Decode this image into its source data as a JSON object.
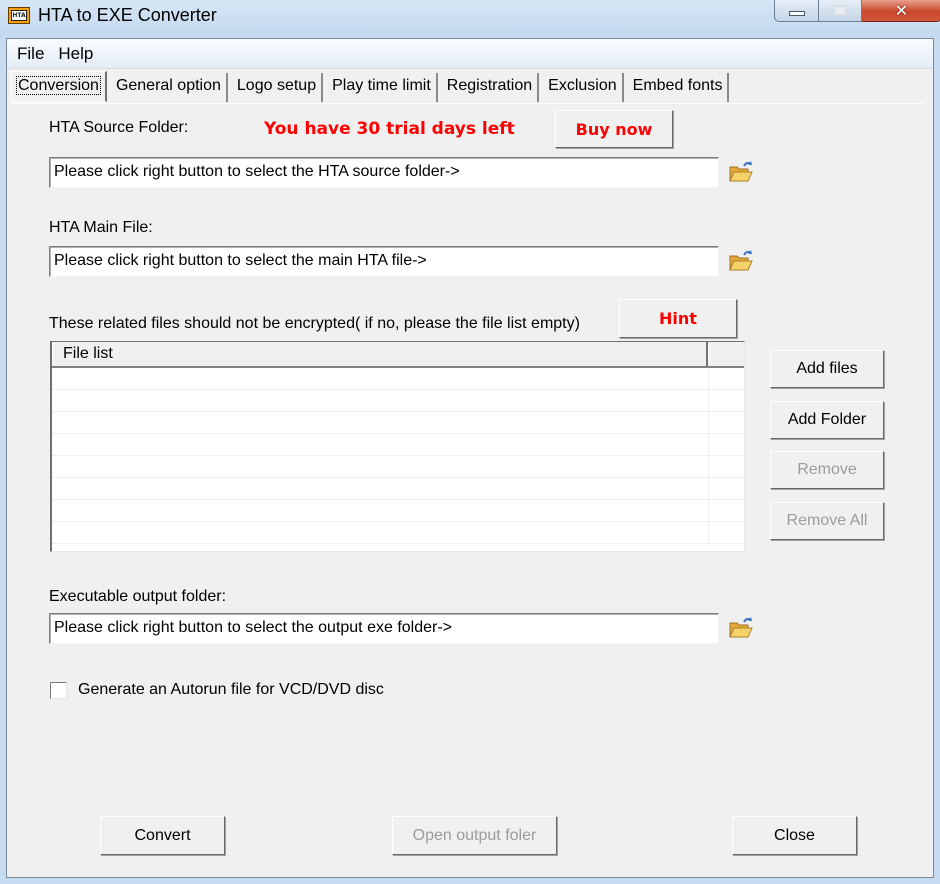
{
  "window": {
    "title": "HTA to EXE Converter",
    "icon_label": "HTA",
    "controls": {
      "minimize": "minimize-icon",
      "maximize": "maximize-icon",
      "close": "close-icon"
    }
  },
  "menu": {
    "items": [
      {
        "label": "File"
      },
      {
        "label": "Help"
      }
    ]
  },
  "tabs": [
    {
      "label": "Conversion",
      "active": true
    },
    {
      "label": "General option"
    },
    {
      "label": "Logo setup"
    },
    {
      "label": "Play time limit"
    },
    {
      "label": "Registration"
    },
    {
      "label": "Exclusion"
    },
    {
      "label": "Embed fonts"
    }
  ],
  "conversion": {
    "source_folder_label": "HTA Source Folder:",
    "trial_notice": "You have 30 trial days left",
    "buy_now_label": "Buy now",
    "source_folder_value": "Please click right button to select the HTA source folder->",
    "main_file_label": "HTA Main File:",
    "main_file_value": "Please click right button to select the main HTA file->",
    "related_files_label": "These related files should not be encrypted( if no, please the file list empty)",
    "hint_label": "Hint",
    "file_list": {
      "columns": [
        "File list",
        ""
      ],
      "rows": []
    },
    "add_files_label": "Add files",
    "add_folder_label": "Add Folder",
    "remove_label": "Remove",
    "remove_all_label": "Remove All",
    "output_folder_label": "Executable output folder:",
    "output_folder_value": "Please click right button to select the output exe folder->",
    "autorun_label": "Generate an Autorun file for VCD/DVD disc",
    "autorun_checked": false,
    "convert_label": "Convert",
    "open_output_label": "Open output foler",
    "close_label": "Close",
    "accent_color": "#ff0000"
  }
}
